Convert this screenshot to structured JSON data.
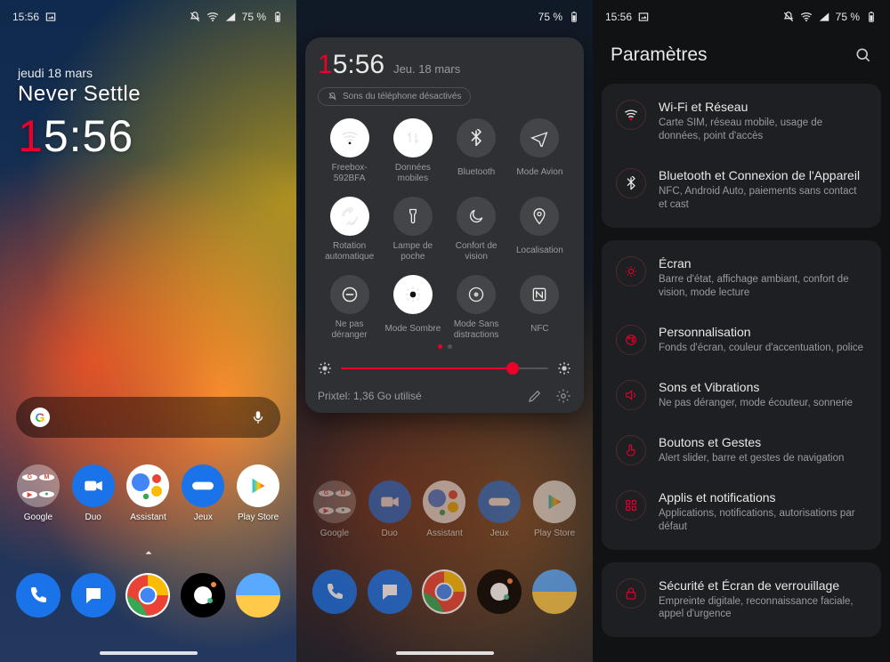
{
  "status": {
    "time": "15:56",
    "battery": "75 %"
  },
  "home": {
    "date": "jeudi 18 mars",
    "motto": "Never Settle",
    "time_h": "1",
    "time_rest": "5:56",
    "apps": [
      {
        "label": "Google"
      },
      {
        "label": "Duo"
      },
      {
        "label": "Assistant"
      },
      {
        "label": "Jeux"
      },
      {
        "label": "Play Store"
      }
    ]
  },
  "qs": {
    "time_h": "1",
    "time_rest": "5:56",
    "date": "Jeu. 18 mars",
    "dnd_text": "Sons du téléphone désactivés",
    "tiles": [
      {
        "label": "Freebox-592BFA",
        "on": true,
        "icon": "wifi"
      },
      {
        "label": "Données mobiles",
        "on": true,
        "icon": "data"
      },
      {
        "label": "Bluetooth",
        "on": false,
        "icon": "bt"
      },
      {
        "label": "Mode Avion",
        "on": false,
        "icon": "plane"
      },
      {
        "label": "Rotation automatique",
        "on": true,
        "icon": "rotate"
      },
      {
        "label": "Lampe de poche",
        "on": false,
        "icon": "torch"
      },
      {
        "label": "Confort de vision",
        "on": false,
        "icon": "moon"
      },
      {
        "label": "Localisation",
        "on": false,
        "icon": "pin"
      },
      {
        "label": "Ne pas déranger",
        "on": false,
        "icon": "dnd"
      },
      {
        "label": "Mode Sombre",
        "on": true,
        "icon": "sun"
      },
      {
        "label": "Mode Sans distractions",
        "on": false,
        "icon": "focus"
      },
      {
        "label": "NFC",
        "on": false,
        "icon": "nfc"
      }
    ],
    "brightness_pct": 83,
    "usage": "Prixtel: 1,36 Go utilisé"
  },
  "settings": {
    "title": "Paramètres",
    "groups": [
      [
        {
          "icon": "wifi",
          "title": "Wi-Fi et Réseau",
          "sub": "Carte SIM, réseau mobile, usage de données, point d'accès"
        },
        {
          "icon": "bt",
          "title": "Bluetooth et Connexion de l'Appareil",
          "sub": "NFC, Android Auto, paiements sans contact et cast"
        }
      ],
      [
        {
          "icon": "display",
          "title": "Écran",
          "sub": "Barre d'état, affichage ambiant, confort de vision, mode lecture"
        },
        {
          "icon": "paint",
          "title": "Personnalisation",
          "sub": "Fonds d'écran, couleur d'accentuation, police"
        },
        {
          "icon": "sound",
          "title": "Sons et Vibrations",
          "sub": "Ne pas déranger, mode écouteur, sonnerie"
        },
        {
          "icon": "gesture",
          "title": "Boutons et Gestes",
          "sub": "Alert slider, barre et gestes de navigation"
        },
        {
          "icon": "apps",
          "title": "Applis et notifications",
          "sub": "Applications, notifications, autorisations par défaut"
        }
      ],
      [
        {
          "icon": "lock",
          "title": "Sécurité et Écran de verrouillage",
          "sub": "Empreinte digitale, reconnaissance faciale, appel d'urgence"
        }
      ]
    ]
  }
}
